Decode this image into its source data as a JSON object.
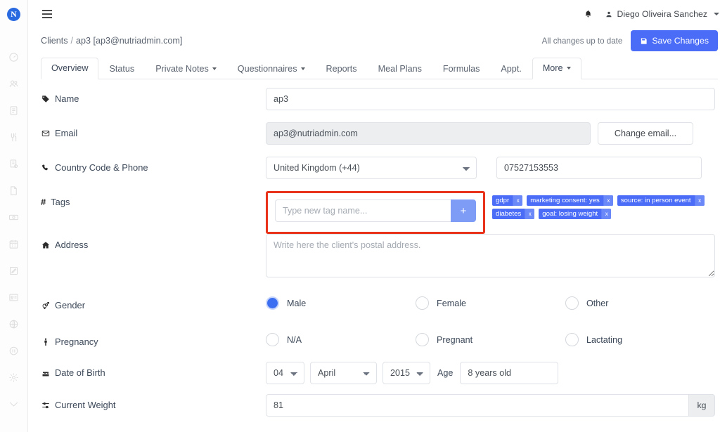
{
  "brand": {
    "logo_letter": "N",
    "accent": "#4a6cf7",
    "highlight": "#e8321a",
    "tag_color": "#4a6cf7"
  },
  "sidebar": {
    "items": [
      {
        "name": "dashboard",
        "icon": "gauge-icon"
      },
      {
        "name": "clients",
        "icon": "users-icon"
      },
      {
        "name": "documents",
        "icon": "document-icon"
      },
      {
        "name": "recipes",
        "icon": "cutlery-icon"
      },
      {
        "name": "reports",
        "icon": "clipboard-icon"
      },
      {
        "name": "notes",
        "icon": "page-icon"
      },
      {
        "name": "payments",
        "icon": "money-icon"
      },
      {
        "name": "calendar",
        "icon": "calendar-icon"
      },
      {
        "name": "edit",
        "icon": "pencil-square-icon"
      },
      {
        "name": "id-card",
        "icon": "id-card-icon"
      },
      {
        "name": "globe",
        "icon": "globe-icon"
      },
      {
        "name": "info",
        "icon": "info-circle-icon"
      },
      {
        "name": "settings",
        "icon": "gear-icon"
      },
      {
        "name": "collapse",
        "icon": "chevron-down-icon"
      }
    ]
  },
  "topbar": {
    "menu_icon": "hamburger-icon",
    "bell_icon": "bell-icon",
    "user_icon": "user-icon",
    "user_name": "Diego Oliveira Sanchez",
    "caret_icon": "caret-down-icon"
  },
  "breadcrumb": {
    "root": "Clients",
    "separator": "/",
    "current": "ap3 [ap3@nutriadmin.com]"
  },
  "save": {
    "status_text": "All changes up to date",
    "button_label": "Save Changes",
    "button_icon": "floppy-disk-icon"
  },
  "tabs": [
    {
      "label": "Overview",
      "active": true,
      "dropdown": false
    },
    {
      "label": "Status",
      "active": false,
      "dropdown": false
    },
    {
      "label": "Private Notes",
      "active": false,
      "dropdown": true
    },
    {
      "label": "Questionnaires",
      "active": false,
      "dropdown": true
    },
    {
      "label": "Reports",
      "active": false,
      "dropdown": false
    },
    {
      "label": "Meal Plans",
      "active": false,
      "dropdown": false
    },
    {
      "label": "Formulas",
      "active": false,
      "dropdown": false
    },
    {
      "label": "Appt.",
      "active": false,
      "dropdown": false
    },
    {
      "label": "More",
      "active": true,
      "dropdown": true
    }
  ],
  "form": {
    "name": {
      "label": "Name",
      "icon": "tag-icon",
      "value": "ap3"
    },
    "email": {
      "label": "Email",
      "icon": "envelope-icon",
      "value": "ap3@nutriadmin.com",
      "change_button": "Change email..."
    },
    "phone": {
      "label": "Country Code & Phone",
      "icon": "phone-icon",
      "country": "United Kingdom (+44)",
      "number": "07527153553"
    },
    "tags": {
      "label": "Tags",
      "icon": "hash-icon",
      "input_placeholder": "Type new tag name...",
      "input_value": "",
      "add_button": "+",
      "list": [
        "gdpr",
        "marketing consent: yes",
        "source: in person event",
        "diabetes",
        "goal: losing weight"
      ],
      "remove_icon": "x"
    },
    "address": {
      "label": "Address",
      "icon": "home-icon",
      "placeholder": "Write here the client's postal address.",
      "value": ""
    },
    "gender": {
      "label": "Gender",
      "icon": "gender-icon",
      "options": [
        "Male",
        "Female",
        "Other"
      ],
      "selected": "Male"
    },
    "pregnancy": {
      "label": "Pregnancy",
      "icon": "person-icon",
      "options": [
        "N/A",
        "Pregnant",
        "Lactating"
      ],
      "selected": ""
    },
    "dob": {
      "label": "Date of Birth",
      "icon": "birthday-cake-icon",
      "day": "04",
      "month": "April",
      "year": "2015",
      "age_label": "Age",
      "age_value": "8 years old"
    },
    "weight": {
      "label": "Current Weight",
      "icon": "sliders-icon",
      "value": "81",
      "unit": "kg"
    }
  }
}
